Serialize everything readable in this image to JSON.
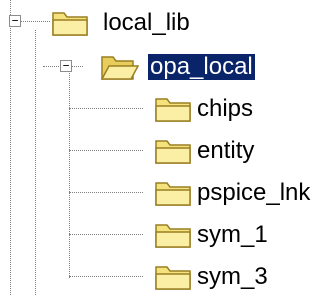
{
  "tree": {
    "root": {
      "label": "local_lib",
      "expander": "−",
      "expanded": true,
      "icon": "folder-closed-icon"
    },
    "selected": {
      "label": "opa_local",
      "expander": "−",
      "expanded": true,
      "icon": "folder-open-icon"
    },
    "children": [
      {
        "label": "chips",
        "icon": "folder-closed-icon"
      },
      {
        "label": "entity",
        "icon": "folder-closed-icon"
      },
      {
        "label": "pspice_lnk",
        "icon": "folder-closed-icon"
      },
      {
        "label": "sym_1",
        "icon": "folder-closed-icon"
      },
      {
        "label": "sym_3",
        "icon": "folder-closed-icon"
      }
    ]
  },
  "colors": {
    "selection_bg": "#0a246a",
    "selection_text": "#ffffff",
    "folder_fill": "#f6e27d",
    "folder_edge": "#9a7f22",
    "tree_lines": "#808080"
  }
}
